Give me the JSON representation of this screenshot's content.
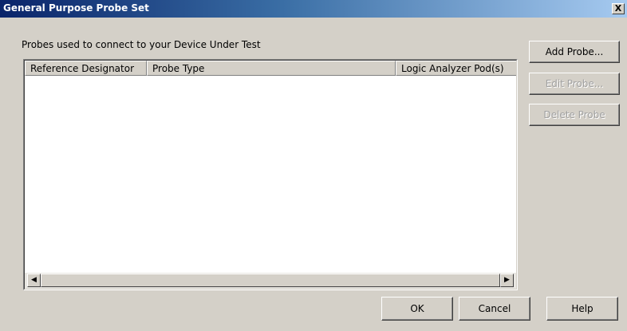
{
  "window": {
    "title": "General Purpose Probe Set",
    "close_glyph": "X"
  },
  "group": {
    "label": "Probes used to connect to your Device Under Test"
  },
  "table": {
    "columns": [
      "Reference Designator",
      "Probe Type",
      "Logic Analyzer Pod(s)"
    ],
    "rows": []
  },
  "scrollbar": {
    "left_glyph": "◀",
    "right_glyph": "▶"
  },
  "side_buttons": {
    "add": "Add Probe...",
    "edit": "Edit Probe...",
    "delete": "Delete Probe"
  },
  "bottom_buttons": {
    "ok": "OK",
    "cancel": "Cancel",
    "help": "Help"
  },
  "colors": {
    "dialog_bg": "#d4d0c8",
    "title_start": "#0a246a",
    "title_end": "#a6caf0",
    "disabled_text": "#a0a0a0"
  }
}
